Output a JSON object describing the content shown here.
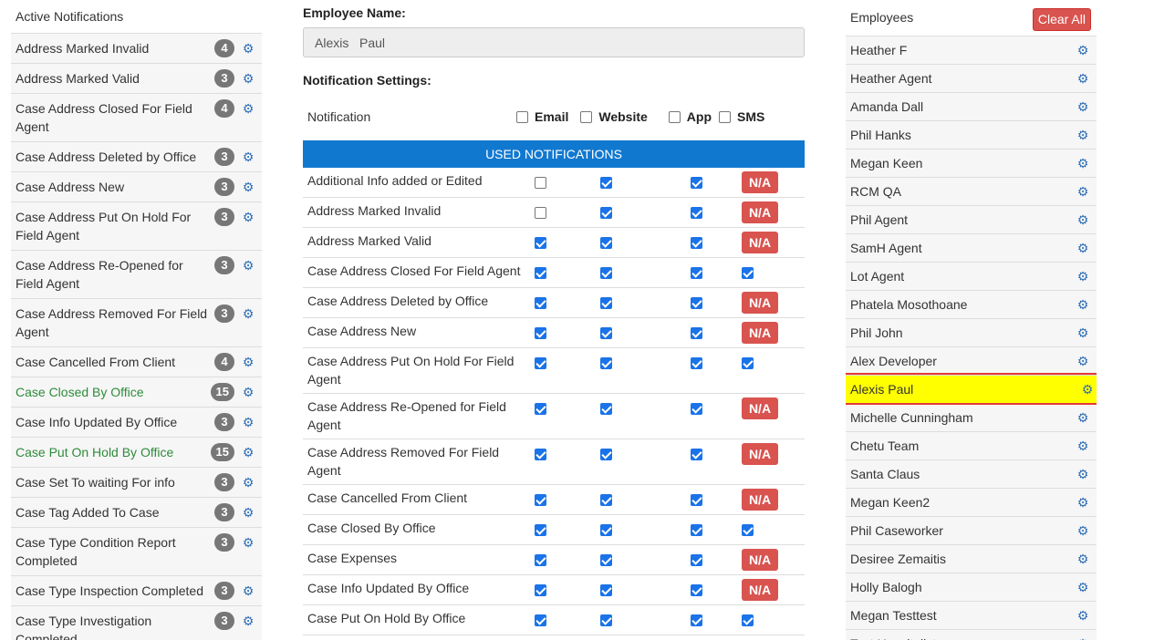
{
  "left": {
    "title": "Active Notifications",
    "items": [
      {
        "label": "Address Marked Invalid",
        "count": "4",
        "green": false
      },
      {
        "label": "Address Marked Valid",
        "count": "3",
        "green": false
      },
      {
        "label": "Case Address Closed For Field Agent",
        "count": "4",
        "green": false
      },
      {
        "label": "Case Address Deleted by Office",
        "count": "3",
        "green": false
      },
      {
        "label": "Case Address New",
        "count": "3",
        "green": false
      },
      {
        "label": "Case Address Put On Hold For Field Agent",
        "count": "3",
        "green": false
      },
      {
        "label": "Case Address Re-Opened for Field Agent",
        "count": "3",
        "green": false
      },
      {
        "label": "Case Address Removed For Field Agent",
        "count": "3",
        "green": false
      },
      {
        "label": "Case Cancelled From Client",
        "count": "4",
        "green": false
      },
      {
        "label": "Case Closed By Office",
        "count": "15",
        "green": true
      },
      {
        "label": "Case Info Updated By Office",
        "count": "3",
        "green": false
      },
      {
        "label": "Case Put On Hold By Office",
        "count": "15",
        "green": true
      },
      {
        "label": "Case Set To waiting For info",
        "count": "3",
        "green": false
      },
      {
        "label": "Case Tag Added To Case",
        "count": "3",
        "green": false
      },
      {
        "label": "Case Type Condition Report Completed",
        "count": "3",
        "green": false
      },
      {
        "label": "Case Type Inspection Completed",
        "count": "3",
        "green": false
      },
      {
        "label": "Case Type Investigation Completed",
        "count": "3",
        "green": false
      }
    ]
  },
  "middle": {
    "employee_name_label": "Employee Name:",
    "employee_name_value": "Alexis   Paul",
    "notification_settings_label": "Notification Settings:",
    "header": {
      "notification": "Notification",
      "email": "Email",
      "website": "Website",
      "app": "App",
      "sms": "SMS"
    },
    "used_bar": "USED NOTIFICATIONS",
    "na_text": "N/A",
    "rows": [
      {
        "name": "Additional Info added or Edited",
        "email": false,
        "website": true,
        "app": true,
        "sms": "na"
      },
      {
        "name": "Address Marked Invalid",
        "email": false,
        "website": true,
        "app": true,
        "sms": "na"
      },
      {
        "name": "Address Marked Valid",
        "email": true,
        "website": true,
        "app": true,
        "sms": "na"
      },
      {
        "name": "Case Address Closed For Field Agent",
        "email": true,
        "website": true,
        "app": true,
        "sms": "on"
      },
      {
        "name": "Case Address Deleted by Office",
        "email": true,
        "website": true,
        "app": true,
        "sms": "na"
      },
      {
        "name": "Case Address New",
        "email": true,
        "website": true,
        "app": true,
        "sms": "na"
      },
      {
        "name": "Case Address Put On Hold For Field Agent",
        "email": true,
        "website": true,
        "app": true,
        "sms": "on"
      },
      {
        "name": "Case Address Re-Opened for Field Agent",
        "email": true,
        "website": true,
        "app": true,
        "sms": "na"
      },
      {
        "name": "Case Address Removed For Field Agent",
        "email": true,
        "website": true,
        "app": true,
        "sms": "na"
      },
      {
        "name": "Case Cancelled From Client",
        "email": true,
        "website": true,
        "app": true,
        "sms": "na"
      },
      {
        "name": "Case Closed By Office",
        "email": true,
        "website": true,
        "app": true,
        "sms": "on"
      },
      {
        "name": "Case Expenses",
        "email": true,
        "website": true,
        "app": true,
        "sms": "na"
      },
      {
        "name": "Case Info Updated By Office",
        "email": true,
        "website": true,
        "app": true,
        "sms": "na"
      },
      {
        "name": "Case Put On Hold By Office",
        "email": true,
        "website": true,
        "app": true,
        "sms": "on"
      }
    ]
  },
  "right": {
    "title": "Employees",
    "clear_all": "Clear All",
    "employees": [
      {
        "name": "Heather F",
        "selected": false
      },
      {
        "name": "Heather Agent",
        "selected": false
      },
      {
        "name": "Amanda Dall",
        "selected": false
      },
      {
        "name": "Phil Hanks",
        "selected": false
      },
      {
        "name": "Megan Keen",
        "selected": false
      },
      {
        "name": "RCM QA",
        "selected": false
      },
      {
        "name": "Phil Agent",
        "selected": false
      },
      {
        "name": "SamH Agent",
        "selected": false
      },
      {
        "name": "Lot Agent",
        "selected": false
      },
      {
        "name": "Phatela Mosothoane",
        "selected": false
      },
      {
        "name": "Phil John",
        "selected": false
      },
      {
        "name": "Alex Developer",
        "selected": false
      },
      {
        "name": "Alexis Paul",
        "selected": true
      },
      {
        "name": "Michelle Cunningham",
        "selected": false
      },
      {
        "name": "Chetu Team",
        "selected": false
      },
      {
        "name": "Santa Claus",
        "selected": false
      },
      {
        "name": "Megan Keen2",
        "selected": false
      },
      {
        "name": "Phil Caseworker",
        "selected": false
      },
      {
        "name": "Desiree Zemaitis",
        "selected": false
      },
      {
        "name": "Holly Balogh",
        "selected": false
      },
      {
        "name": "Megan Testtest",
        "selected": false
      },
      {
        "name": "Test Hospitalist",
        "selected": false
      }
    ]
  },
  "colors": {
    "accent_blue": "#1178d0",
    "danger_red": "#d9534f",
    "badge_gray": "#777777",
    "green_text": "#2e8b3a",
    "highlight_yellow": "#ffff00",
    "gear_blue": "#2f6eb5"
  },
  "icons": {
    "gear": "gear-icon"
  }
}
